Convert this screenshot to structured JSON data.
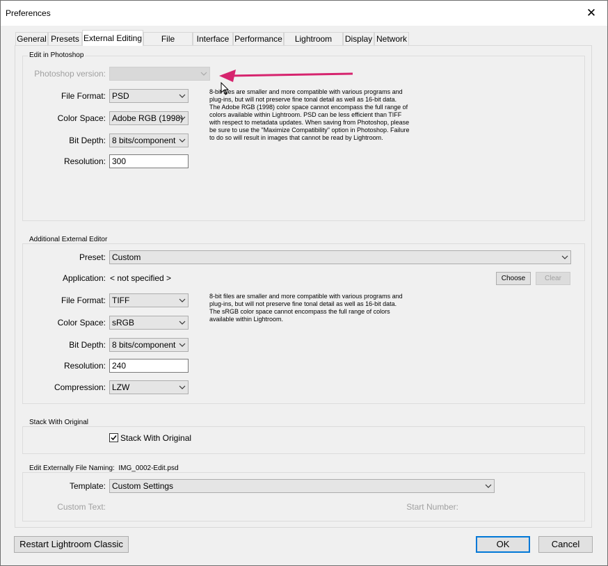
{
  "window": {
    "title": "Preferences"
  },
  "tabs": [
    "General",
    "Presets",
    "External Editing",
    "File Handling",
    "Interface",
    "Performance",
    "Lightroom Sync",
    "Display",
    "Network"
  ],
  "active_tab": "External Editing",
  "photoshop": {
    "group_label": "Edit in Photoshop",
    "version_label": "Photoshop version:",
    "version_value": "",
    "file_format_label": "File Format:",
    "file_format": "PSD",
    "color_space_label": "Color Space:",
    "color_space": "Adobe RGB (1998)",
    "bit_depth_label": "Bit Depth:",
    "bit_depth": "8 bits/component",
    "resolution_label": "Resolution:",
    "resolution": "300",
    "help_lines": [
      "8-bit files are smaller and more compatible with various programs and",
      "plug-ins, but will not preserve fine tonal detail as well as 16-bit data.",
      "The Adobe RGB (1998) color space cannot encompass the full range of",
      "colors available within Lightroom. PSD can be less efficient than TIFF",
      "with respect to metadata updates. When saving from Photoshop, please",
      "be sure to use the \"Maximize Compatibility\" option in Photoshop. Failure",
      "to do so will result in images that cannot be read by Lightroom."
    ]
  },
  "additional": {
    "group_label": "Additional External Editor",
    "preset_label": "Preset:",
    "preset": "Custom",
    "application_label": "Application:",
    "application": "< not specified >",
    "choose_label": "Choose",
    "clear_label": "Clear",
    "file_format_label": "File Format:",
    "file_format": "TIFF",
    "color_space_label": "Color Space:",
    "color_space": "sRGB",
    "bit_depth_label": "Bit Depth:",
    "bit_depth": "8 bits/component",
    "resolution_label": "Resolution:",
    "resolution": "240",
    "compression_label": "Compression:",
    "compression": "LZW",
    "help_lines": [
      "8-bit files are smaller and more compatible with various programs and",
      "plug-ins, but will not preserve fine tonal detail as well as 16-bit data.",
      "The sRGB color space cannot encompass the full range of colors",
      "available within Lightroom."
    ]
  },
  "stack": {
    "group_label": "Stack With Original",
    "checkbox_label": "Stack With Original",
    "checked": true
  },
  "naming": {
    "group_label": "Edit Externally File Naming:",
    "example": "IMG_0002-Edit.psd",
    "template_label": "Template:",
    "template": "Custom Settings",
    "custom_text_label": "Custom Text:",
    "start_number_label": "Start Number:"
  },
  "footer": {
    "restart_label": "Restart Lightroom Classic",
    "ok_label": "OK",
    "cancel_label": "Cancel"
  },
  "colors": {
    "annotation_arrow": "#d6246e",
    "default_button_border": "#0078d7"
  }
}
